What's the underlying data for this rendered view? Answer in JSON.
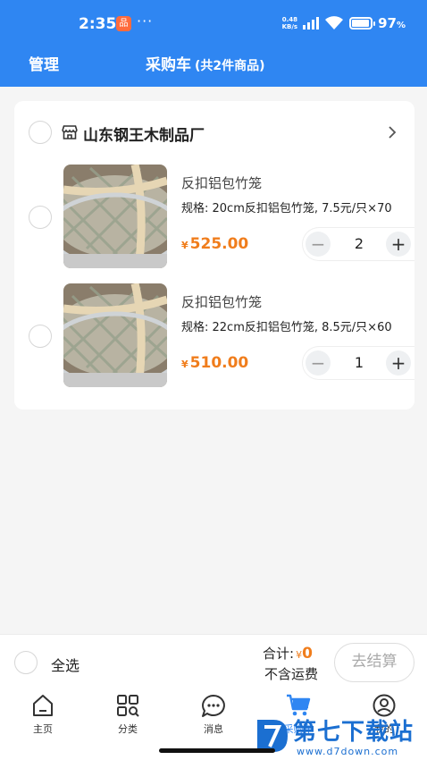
{
  "status_bar": {
    "time": "2:35",
    "app_badge": "品",
    "dots": "···",
    "speed_value": "0.48",
    "speed_unit": "KB/s",
    "battery": "97",
    "battery_unit": "%",
    "battery_level": 0.97
  },
  "header": {
    "manage_label": "管理",
    "title": "采购车",
    "count_label": "(共2件商品)"
  },
  "shop": {
    "name": "山东钢王木制品厂",
    "items": [
      {
        "title": "反扣铝包竹笼",
        "spec": "规格: 20cm反扣铝包竹笼, 7.5元/只×70",
        "currency": "¥",
        "price": "525.00",
        "quantity": "2",
        "minus": "−",
        "plus": "+"
      },
      {
        "title": "反扣铝包竹笼",
        "spec": "规格: 22cm反扣铝包竹笼, 8.5元/只×60",
        "currency": "¥",
        "price": "510.00",
        "quantity": "1",
        "minus": "−",
        "plus": "+"
      }
    ]
  },
  "checkout": {
    "select_all_label": "全选",
    "total_label": "合计:",
    "currency": "¥",
    "total_amount": "0",
    "shipping_note": "不含运费",
    "checkout_button": "去结算"
  },
  "tabs": [
    {
      "label": "主页",
      "icon": "home-icon"
    },
    {
      "label": "分类",
      "icon": "category-icon"
    },
    {
      "label": "消息",
      "icon": "message-icon"
    },
    {
      "label": "采购车",
      "icon": "cart-icon",
      "active": true
    },
    {
      "label": "我的",
      "icon": "profile-icon"
    }
  ],
  "watermark": {
    "text": "第七下载站",
    "url": "www.d7down.com"
  },
  "colors": {
    "header_blue": "#2f86f2",
    "price_orange": "#f07d1c",
    "active_tab_blue": "#2f86f2",
    "watermark_blue": "#1b6fd1"
  }
}
